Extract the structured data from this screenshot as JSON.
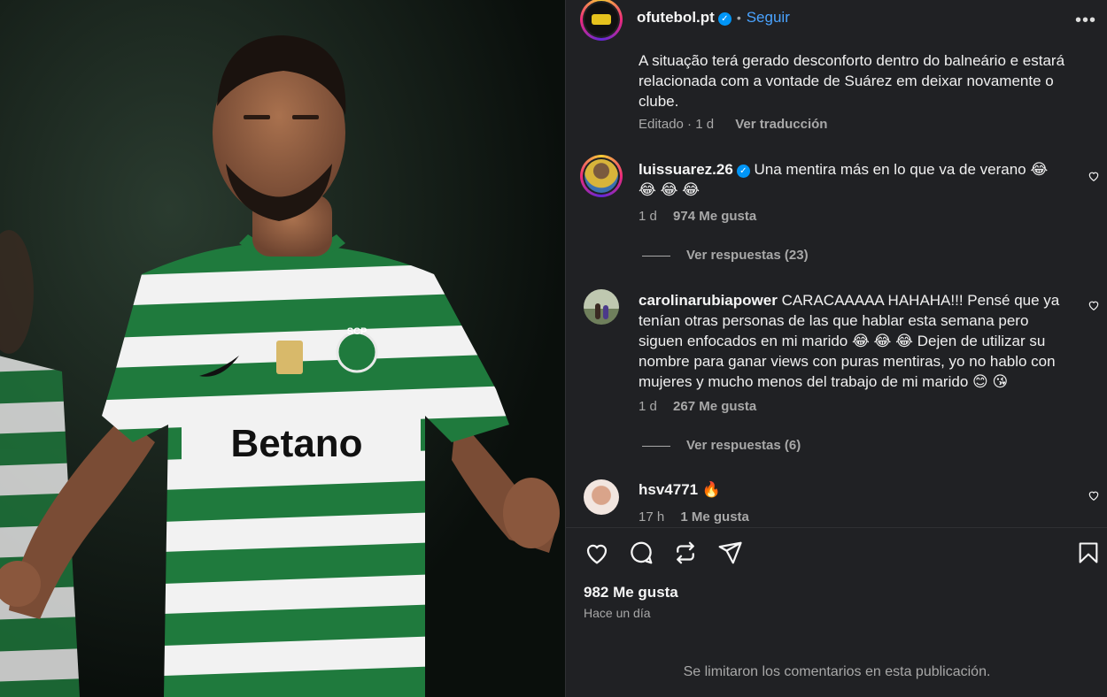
{
  "post": {
    "author": "ofutebol.pt",
    "follow_label": "Seguir",
    "more_label": "•••",
    "caption_lines": [
      "A situação terá gerado desconforto dentro do balneário e estará",
      "relacionada com a vontade de Suárez em deixar novamente o",
      "clube."
    ],
    "edited_label": "Editado",
    "edited_sep": "·",
    "edited_time": "1 d",
    "translate_label": "Ver traducción",
    "likes_text": "982 Me gusta",
    "time_ago": "Hace un día",
    "comments_limited": "Se limitaron los comentarios en esta publicación."
  },
  "comments": [
    {
      "user": "luissuarez.26",
      "verified": true,
      "lines": [
        "Una mentira más en lo que va de verano 😂",
        "😂 😂 😂"
      ],
      "time": "1 d",
      "likes": "974 Me gusta",
      "replies": "Ver respuestas (23)"
    },
    {
      "user": "carolinarubiapower",
      "verified": false,
      "lines": [
        "CARACAAAAA HAHAHA!!! Pensé que ya",
        "tenían otras personas de las que hablar esta semana pero",
        "siguen enfocados en mi marido 😂 😂 😂  Dejen de utilizar su",
        "nombre para ganar views con puras mentiras, yo no hablo con",
        "mujeres y mucho menos del trabajo de mi marido  😊 😘"
      ],
      "time": "1 d",
      "likes": "267 Me gusta",
      "replies": "Ver respuestas (6)"
    },
    {
      "user": "hsv4771",
      "verified": false,
      "lines": [
        "🔥"
      ],
      "time": "17 h",
      "likes": "1 Me gusta"
    }
  ],
  "photo": {
    "crest_text": "SCP",
    "sponsor": "Betano"
  },
  "colors": {
    "panel_bg": "#202124",
    "link_blue": "#4aa3ff",
    "stripe_green": "#1f7a3d"
  },
  "icons": [
    "heart-icon",
    "comment-icon",
    "repost-icon",
    "share-icon",
    "bookmark-icon",
    "verified-icon",
    "more-icon"
  ]
}
